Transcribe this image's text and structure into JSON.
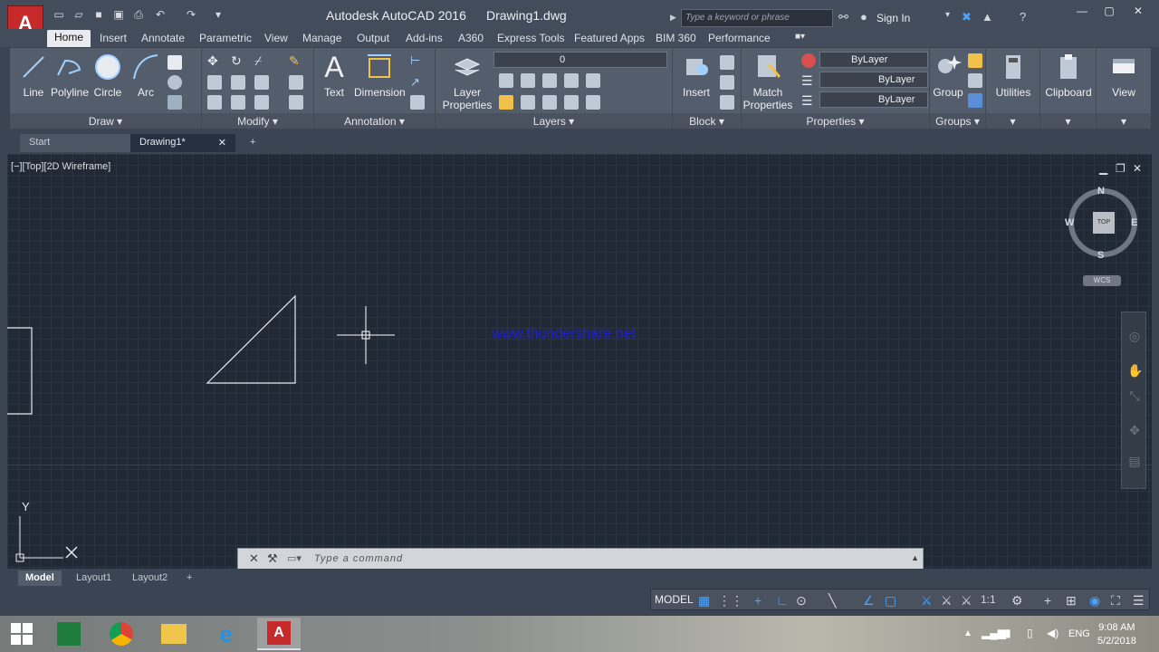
{
  "titlebar": {
    "app_title": "Autodesk AutoCAD 2016",
    "document": "Drawing1.dwg",
    "search_placeholder": "Type a keyword or phrase",
    "signin": "Sign In"
  },
  "ribbon_tabs": [
    "Home",
    "Insert",
    "Annotate",
    "Parametric",
    "View",
    "Manage",
    "Output",
    "Add-ins",
    "A360",
    "Express Tools",
    "Featured Apps",
    "BIM 360",
    "Performance"
  ],
  "ribbon": {
    "draw": {
      "label": "Draw",
      "line": "Line",
      "polyline": "Polyline",
      "circle": "Circle",
      "arc": "Arc"
    },
    "modify": {
      "label": "Modify"
    },
    "annotation": {
      "label": "Annotation",
      "text": "Text",
      "dimension": "Dimension"
    },
    "layers": {
      "label": "Layers",
      "layer_properties_1": "Layer",
      "layer_properties_2": "Properties",
      "current_layer": "0"
    },
    "block": {
      "label": "Block",
      "insert": "Insert"
    },
    "properties": {
      "label": "Properties",
      "match_1": "Match",
      "match_2": "Properties",
      "color": "ByLayer",
      "linetype": "ByLayer",
      "lineweight": "ByLayer"
    },
    "groups": {
      "label": "Groups",
      "group": "Group"
    },
    "utilities": "Utilities",
    "clipboard": "Clipboard",
    "view": "View"
  },
  "doc_tabs": {
    "start": "Start",
    "drawing": "Drawing1*"
  },
  "viewport": {
    "label": "[−][Top][2D Wireframe]",
    "watermark": "www.thundershare.net",
    "viewcube": {
      "top": "TOP",
      "n": "N",
      "s": "S",
      "e": "E",
      "w": "W",
      "wcs": "WCS"
    },
    "ucs": {
      "y": "Y"
    }
  },
  "command": {
    "placeholder": "Type a command"
  },
  "layout_tabs": [
    "Model",
    "Layout1",
    "Layout2"
  ],
  "status": {
    "model": "MODEL",
    "scale": "1:1"
  },
  "taskbar": {
    "lang": "ENG",
    "time": "9:08 AM",
    "date": "5/2/2018"
  },
  "colors": {
    "accent": "#c62a2a",
    "watermark": "#1f1fd6",
    "crosshair": "#ffffff"
  }
}
